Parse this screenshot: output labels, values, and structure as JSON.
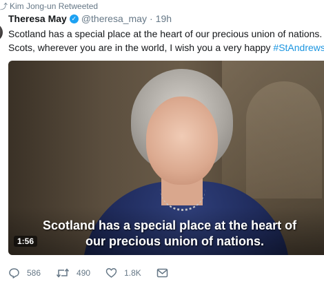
{
  "retweet_context": {
    "icon": "retweet-small-icon",
    "text": "Kim Jong-un Retweeted"
  },
  "tweet": {
    "author_name": "Theresa May",
    "verified_icon": "verified-badge-icon",
    "handle": "@theresa_may",
    "separator": "·",
    "time": "19h",
    "text_line1": "Scotland has a special place at the heart of our precious union of nations. T",
    "text_line2_prefix": "Scots, wherever you are in the world, I wish you a very happy ",
    "hashtag": "#StAndrewsD"
  },
  "video": {
    "subtitle_line1": "Scotland has a special place at the heart of",
    "subtitle_line2": "our precious union of nations.",
    "duration": "1:56"
  },
  "actions": {
    "reply_count": "586",
    "retweet_count": "490",
    "like_count": "1.8K",
    "colors": {
      "muted": "#657786",
      "link": "#1b95e0",
      "verified": "#1da1f2"
    }
  }
}
